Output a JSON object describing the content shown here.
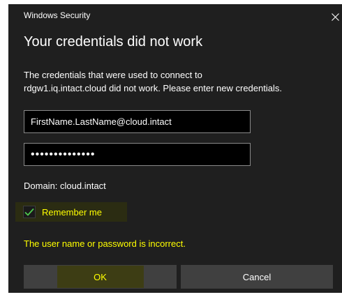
{
  "window": {
    "app_title": "Windows Security",
    "close_icon": "close-icon"
  },
  "heading": "Your credentials did not work",
  "message": {
    "line1": "The credentials that were used to connect to",
    "line2": "rdgw1.iq.intact.cloud did not work. Please enter new credentials."
  },
  "username": {
    "value": "FirstName.LastName@cloud.intact"
  },
  "password": {
    "masked_value": "••••••••••••••"
  },
  "domain": {
    "label": "Domain: cloud.intact"
  },
  "remember_me": {
    "label": "Remember me",
    "checked": true,
    "check_icon": "checkmark-icon"
  },
  "error": {
    "text": "The user name or password is incorrect."
  },
  "buttons": {
    "ok_label": "OK",
    "cancel_label": "Cancel"
  },
  "colors": {
    "background": "#1f1f1f",
    "highlight_text": "#ffff00",
    "checkmark": "#4ec94e",
    "button": "#404040",
    "field_border": "#8a8a8a"
  }
}
